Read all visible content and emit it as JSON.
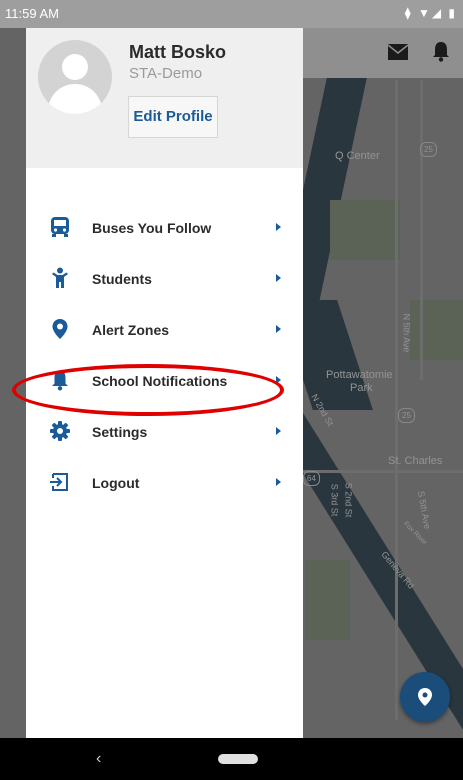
{
  "status_bar": {
    "time": "11:59 AM",
    "system_icons": "⧫ ▼◢ ▮"
  },
  "drawer": {
    "user_name": "Matt Bosko",
    "user_org": "STA-Demo",
    "edit_profile_label": "Edit Profile",
    "menu": [
      {
        "label": "Buses You Follow",
        "icon": "bus-icon"
      },
      {
        "label": "Students",
        "icon": "student-icon"
      },
      {
        "label": "Alert Zones",
        "icon": "location-pin-icon"
      },
      {
        "label": "School Notifications",
        "icon": "bell-icon"
      },
      {
        "label": "Settings",
        "icon": "gear-icon"
      },
      {
        "label": "Logout",
        "icon": "logout-icon"
      }
    ]
  },
  "map": {
    "labels": {
      "q_center": "Q Center",
      "route_25_a": "25",
      "route_25_b": "25",
      "route_64": "64",
      "pottawatomie": "Pottawatomie",
      "park": "Park",
      "st_charles": "St. Charles",
      "n_5th_ave": "N 5th Ave",
      "n_2nd_st": "N 2nd St",
      "s_2nd_st": "S 2nd St",
      "s_3rd_st": "S 3rd St",
      "s_5th_ave": "S 5th Ave",
      "geneva_rd": "Geneva Rd",
      "fox_river": "Fox River"
    }
  },
  "colors": {
    "accent": "#1a5b99",
    "highlight": "#e00000",
    "fab": "#1a4d7a"
  },
  "annotation": {
    "highlighted_item": "School Notifications"
  }
}
